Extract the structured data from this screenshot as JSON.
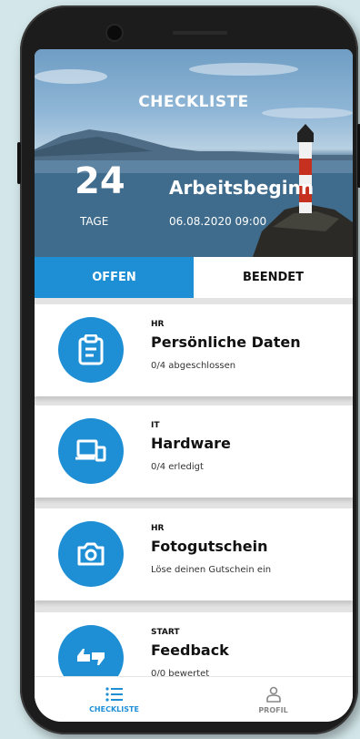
{
  "header": {
    "title": "CHECKLISTE",
    "days_count": "24",
    "days_label": "TAGE",
    "event_title": "Arbeitsbeginn",
    "event_datetime": "06.08.2020 09:00"
  },
  "tabs": [
    {
      "label": "OFFEN",
      "active": true
    },
    {
      "label": "BEENDET",
      "active": false
    }
  ],
  "items": [
    {
      "category": "HR",
      "title": "Persönliche Daten",
      "subtitle": "0/4 abgeschlossen",
      "icon": "clipboard-icon"
    },
    {
      "category": "IT",
      "title": "Hardware",
      "subtitle": "0/4 erledigt",
      "icon": "devices-icon"
    },
    {
      "category": "HR",
      "title": "Fotogutschein",
      "subtitle": "Löse deinen Gutschein ein",
      "icon": "camera-icon"
    },
    {
      "category": "START",
      "title": "Feedback",
      "subtitle": "0/0 bewertet",
      "icon": "thumbs-icon"
    }
  ],
  "bottom_nav": [
    {
      "label": "CHECKLISTE",
      "icon": "list-icon",
      "active": true
    },
    {
      "label": "PROFIL",
      "icon": "profile-icon",
      "active": false
    }
  ],
  "colors": {
    "accent": "#1e8fd5",
    "background": "#d3e7ea",
    "text": "#111111"
  }
}
